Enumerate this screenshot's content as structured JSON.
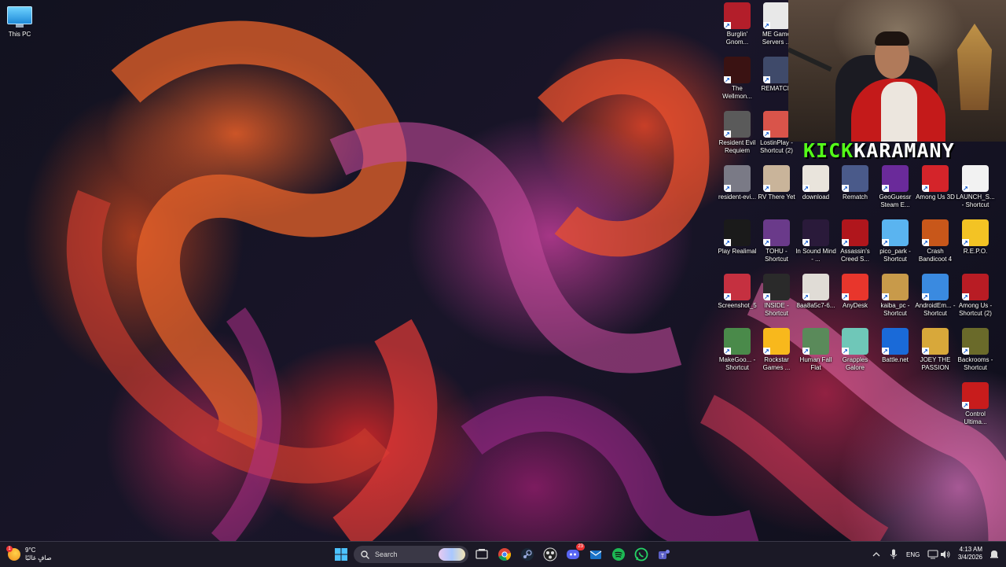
{
  "desktop": {
    "this_pc_label": "This PC",
    "icons": [
      {
        "label": "Burglin' Gnom...",
        "icon": "gnome-game-icon",
        "color": "#b31e2a"
      },
      {
        "label": "ME Game Servers ...",
        "icon": "servers-grid-icon",
        "color": "#e8e8e8"
      },
      {
        "label": "The Wellmon...",
        "icon": "wellmon-game-icon",
        "color": "#3a1212"
      },
      {
        "label": "REMATCH",
        "icon": "rematch-ball-icon",
        "color": "#3f4a6a"
      },
      {
        "label": "Resident Evil Requiem",
        "icon": "resident-evil-icon",
        "color": "#5a5a5a"
      },
      {
        "label": "LostinPlay - Shortcut (2)",
        "icon": "lostinplay-icon",
        "color": "#d9544a"
      },
      {
        "label": "resident-evi...",
        "icon": "image-file-icon",
        "color": "#7a7a86"
      },
      {
        "label": "RV There Yet",
        "icon": "rv-game-icon",
        "color": "#c9b49a"
      },
      {
        "label": "download",
        "icon": "image-file-icon",
        "color": "#e9e4dc"
      },
      {
        "label": "Rematch",
        "icon": "image-file-icon",
        "color": "#4a5a8a"
      },
      {
        "label": "GeoGuessr Steam E...",
        "icon": "geoguessr-pin-icon",
        "color": "#6a2a9a"
      },
      {
        "label": "Among Us 3D",
        "icon": "among-us-icon",
        "color": "#d4242a"
      },
      {
        "label": "LAUNCH_S... - Shortcut",
        "icon": "gear-file-icon",
        "color": "#f2f2f2"
      },
      {
        "label": "Play Realimal",
        "icon": "realimal-icon",
        "color": "#1a1a1a"
      },
      {
        "label": "TOHU - Shortcut",
        "icon": "tohu-icon",
        "color": "#6a3a8a"
      },
      {
        "label": "In Sound Mind - ...",
        "icon": "in-sound-mind-icon",
        "color": "#2a1a3a"
      },
      {
        "label": "Assassin's Creed S...",
        "icon": "assassins-creed-icon",
        "color": "#b0161c"
      },
      {
        "label": "pico_park - Shortcut",
        "icon": "pico-park-icon",
        "color": "#5ab4f0"
      },
      {
        "label": "Crash Bandicoot 4",
        "icon": "crash-bandicoot-icon",
        "color": "#c8571a"
      },
      {
        "label": "R.E.P.O.",
        "icon": "repo-emoji-icon",
        "color": "#f3c324"
      },
      {
        "label": "Screenshot_5",
        "icon": "image-file-icon",
        "color": "#c53040"
      },
      {
        "label": "INSIDE - Shortcut",
        "icon": "inside-game-icon",
        "color": "#2a2a2a"
      },
      {
        "label": "8aa8a5c7-6...",
        "icon": "image-file-icon",
        "color": "#e0dcd6"
      },
      {
        "label": "AnyDesk",
        "icon": "anydesk-icon",
        "color": "#e8362c"
      },
      {
        "label": "kaiba_pc - Shortcut",
        "icon": "kaiba-icon",
        "color": "#c89a4a"
      },
      {
        "label": "AndroidEm... - Shortcut",
        "icon": "android-emulator-icon",
        "color": "#3a8ae0"
      },
      {
        "label": "Among Us - Shortcut (2)",
        "icon": "among-us-icon",
        "color": "#b81c24"
      },
      {
        "label": "MakeGoo... - Shortcut",
        "icon": "makegoo-icon",
        "color": "#4a8a4a"
      },
      {
        "label": "Rockstar Games ...",
        "icon": "rockstar-icon",
        "color": "#f8b81c"
      },
      {
        "label": "Human Fall Flat",
        "icon": "human-fall-flat-icon",
        "color": "#5a8a5a"
      },
      {
        "label": "Grapples Galore",
        "icon": "grapples-galore-icon",
        "color": "#6fc7b8"
      },
      {
        "label": "Battle.net",
        "icon": "battlenet-icon",
        "color": "#1a6ad8"
      },
      {
        "label": "JOEY THE PASSION",
        "icon": "joey-icon",
        "color": "#d8a83a"
      },
      {
        "label": "Backrooms - Shortcut",
        "icon": "backrooms-icon",
        "color": "#6a6a2a"
      },
      {
        "label": "Control Ultima...",
        "icon": "control-icon",
        "color": "#c81c1c"
      }
    ]
  },
  "overlay": {
    "kick_text": "KICK",
    "name_text": "KARAMANY",
    "kick_color": "#53fc18"
  },
  "taskbar": {
    "weather": {
      "temp": "9°C",
      "condition": "صافٍ غالبًا",
      "badge": "1"
    },
    "search_placeholder": "Search",
    "apps": [
      "windows-start-icon",
      "task-view-icon",
      "chrome-icon",
      "steam-icon",
      "obs-icon",
      "discord-icon",
      "outlook-icon",
      "spotify-icon",
      "whatsapp-icon",
      "teams-icon"
    ],
    "discord_badge": "23",
    "language": "ENG",
    "time": "4:13 AM",
    "date": "3/4/2026"
  }
}
